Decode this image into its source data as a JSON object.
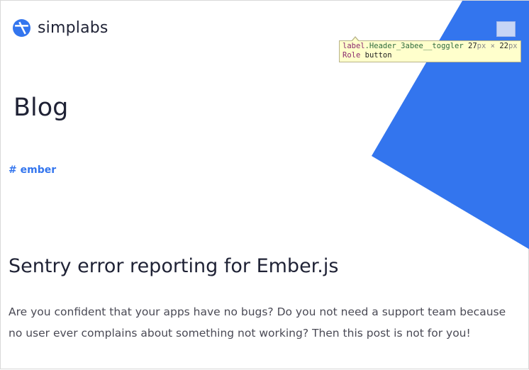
{
  "header": {
    "brand": "simplabs",
    "logo_icon": "simplabs-logo-icon",
    "menu_toggle_icon": "menu-toggle-icon"
  },
  "inspector_tooltip": {
    "selector_tag": "label",
    "selector_class": ".Header_3abee__toggler",
    "width": "27",
    "height": "22",
    "unit": "px",
    "times": "×",
    "role_key": "Role",
    "role_value": "button"
  },
  "main": {
    "title": "Blog",
    "tag": "# ember",
    "post": {
      "title": "Sentry error reporting for Ember.js",
      "excerpt": "Are you confident that your apps have no bugs? Do you not need a support team because no user ever complains about something not working? Then this post is not for you!"
    }
  },
  "colors": {
    "accent": "#3375ee",
    "text_dark": "#1f2235"
  }
}
